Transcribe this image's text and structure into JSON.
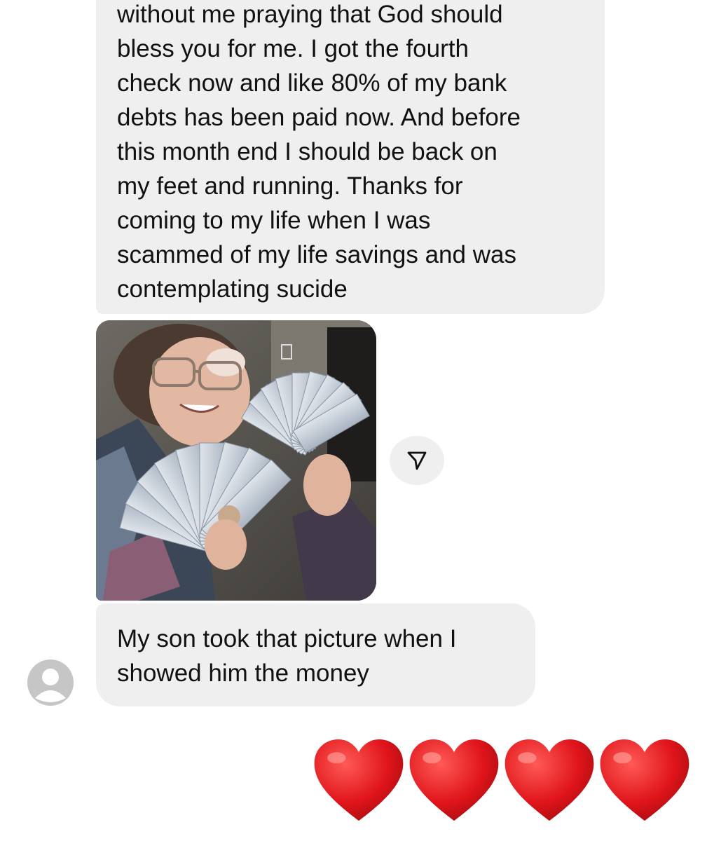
{
  "thread": {
    "message_1_lines": [
      "without me praying that God should",
      "bless you for me. I got the fourth",
      "check now and like 80% of my bank",
      "debts has been paid now. And before",
      "this month end I should be  back on",
      "my feet and running. Thanks for",
      "coming to my life when I was",
      "scammed of my life savings and was",
      "contemplating  sucide"
    ],
    "photo_icon": "photo-of-woman-holding-cash",
    "share_icon": "send-paper-plane-icon",
    "message_2_lines": [
      "My son took that picture when I",
      "showed him the money"
    ],
    "avatar_icon": "default-user-avatar-icon",
    "reaction_hearts": [
      "❤️",
      "❤️",
      "❤️",
      "❤️"
    ]
  },
  "colors": {
    "bubble": "#efefef",
    "text": "#111111",
    "heart": "#e0151b",
    "avatar": "#c6c6c6"
  }
}
